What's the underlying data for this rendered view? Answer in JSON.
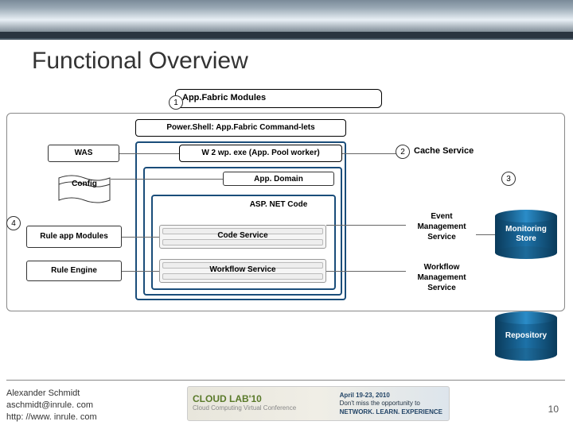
{
  "title": "Functional Overview",
  "appfabric_modules": "App.Fabric Modules",
  "powershell": "Power.Shell: App.Fabric Command-lets",
  "w2wp": "W 2 wp. exe (App. Pool worker)",
  "appdomain": "App. Domain",
  "aspnet": "ASP. NET Code",
  "code_service": "Code Service",
  "workflow_service": "Workflow Service",
  "was": "WAS",
  "config": "Config",
  "rule_app_modules": "Rule app Modules",
  "rule_engine": "Rule Engine",
  "cache_service": "Cache Service",
  "event_mgmt": "Event Management Service",
  "workflow_mgmt": "Workflow Management Service",
  "monitoring_store": "Monitoring Store",
  "repository": "Repository",
  "circles": {
    "c1": "1",
    "c2": "2",
    "c3": "3",
    "c4": "4"
  },
  "author": {
    "name": "Alexander Schmidt",
    "email": "aschmidt@inrule. com",
    "url": "http: //www. inrule. com"
  },
  "page_number": "10",
  "banner": {
    "brand": "CLOUD LAB'10",
    "sub": "Cloud Computing Virtual Conference",
    "date": "April 19-23, 2010",
    "tag1": "Don't miss the opportunity to",
    "tag2": "NETWORK. LEARN. EXPERIENCE"
  }
}
